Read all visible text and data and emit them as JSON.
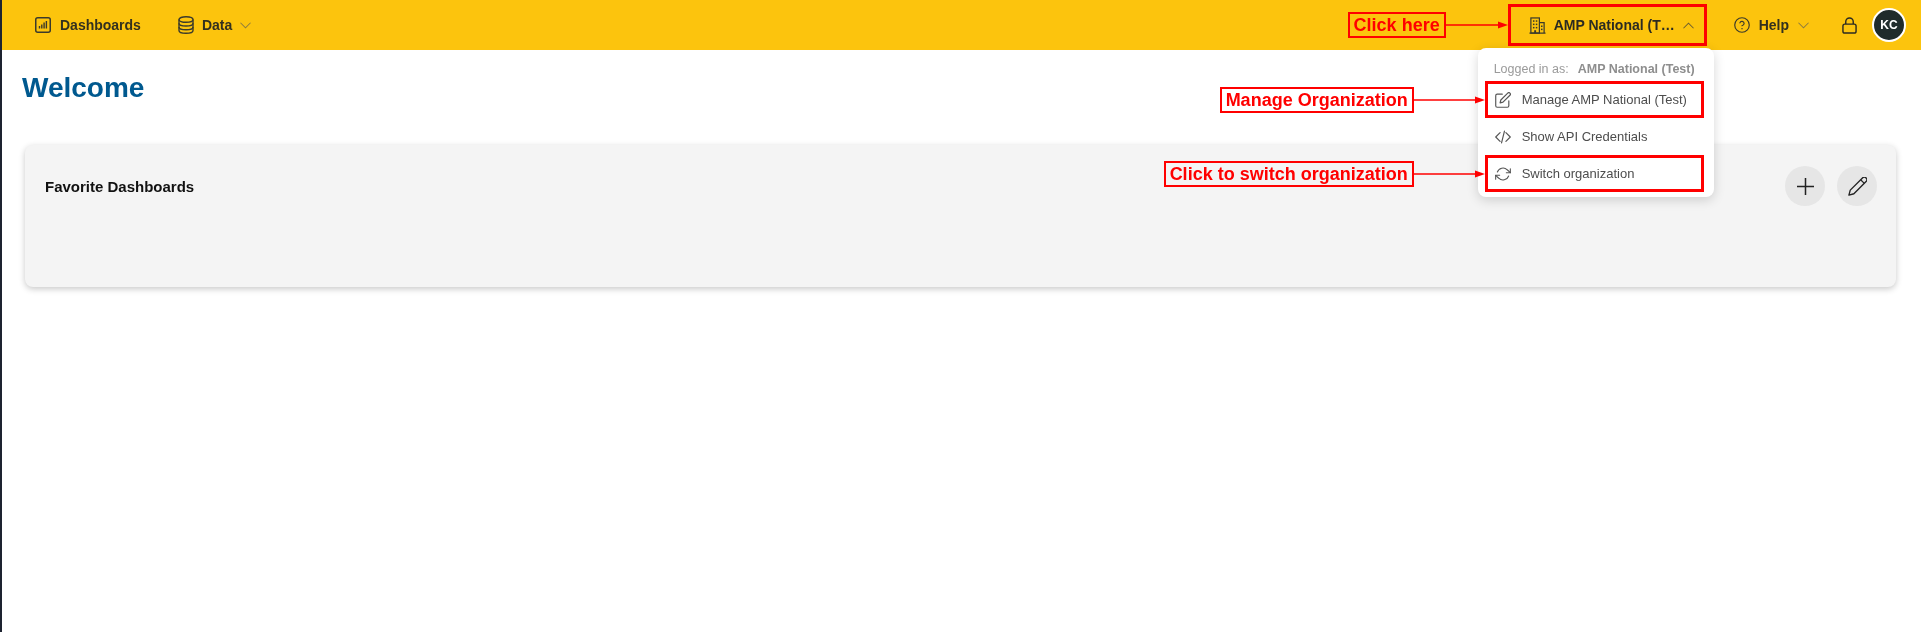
{
  "dashboards_link": {
    "label": "Dashboards"
  },
  "data_menu": {
    "label": "Data",
    "expanded": false
  },
  "org_menu": {
    "label": "AMP National (T…",
    "expanded": true,
    "highlighted": true,
    "callout": "Click here"
  },
  "help_menu": {
    "label": "Help",
    "expanded": false
  },
  "avatar": {
    "initials": "KC"
  },
  "dropdown": {
    "logged_in_label": "Logged in as:",
    "logged_in_name": "AMP National (Test)",
    "items": [
      {
        "kind": "edit",
        "label": "Manage AMP National (Test)",
        "highlighted": true,
        "callout": "Manage Organization"
      },
      {
        "kind": "code",
        "label": "Show API Credentials",
        "highlighted": false
      },
      {
        "kind": "switch",
        "label": "Switch organization",
        "highlighted": true,
        "callout": "Click to switch organization"
      }
    ]
  },
  "welcome_title": "Welcome",
  "favorites": {
    "title": "Favorite Dashboards"
  }
}
